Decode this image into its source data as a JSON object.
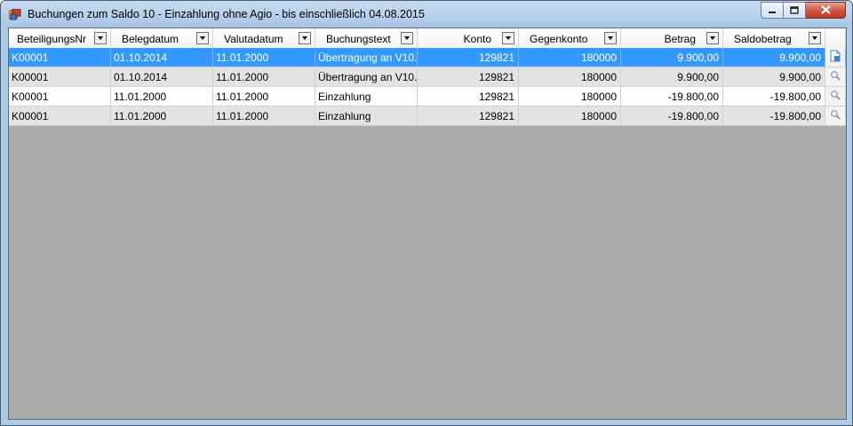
{
  "window": {
    "title": "Buchungen zum Saldo 10 - Einzahlung ohne Agio - bis einschließlich 04.08.2015",
    "app_icon": "app-window-icon",
    "caption_buttons": [
      "minimize-icon",
      "maximize-icon",
      "close-icon"
    ]
  },
  "grid": {
    "columns": [
      {
        "label": "BeteiligungsNr"
      },
      {
        "label": "Belegdatum"
      },
      {
        "label": "Valutadatum"
      },
      {
        "label": "Buchungstext"
      },
      {
        "label": "Konto"
      },
      {
        "label": "Gegenkonto"
      },
      {
        "label": "Betrag"
      },
      {
        "label": "Saldobetrag"
      }
    ],
    "rows": [
      {
        "beteiligungsnr": "K00001",
        "belegdatum": "01.10.2014",
        "valutadatum": "11.01.2000",
        "buchungstext": "Übertragung an V10...",
        "konto": "129821",
        "gegenkonto": "180000",
        "betrag": "9.900,00",
        "saldobetrag": "9.900,00",
        "icon": "document-icon",
        "selected": true
      },
      {
        "beteiligungsnr": "K00001",
        "belegdatum": "01.10.2014",
        "valutadatum": "11.01.2000",
        "buchungstext": "Übertragung an V10...",
        "konto": "129821",
        "gegenkonto": "180000",
        "betrag": "9.900,00",
        "saldobetrag": "9.900,00",
        "icon": "magnifier-icon",
        "selected": false
      },
      {
        "beteiligungsnr": "K00001",
        "belegdatum": "11.01.2000",
        "valutadatum": "11.01.2000",
        "buchungstext": "Einzahlung",
        "konto": "129821",
        "gegenkonto": "180000",
        "betrag": "-19.800,00",
        "saldobetrag": "-19.800,00",
        "icon": "magnifier-icon",
        "selected": false
      },
      {
        "beteiligungsnr": "K00001",
        "belegdatum": "11.01.2000",
        "valutadatum": "11.01.2000",
        "buchungstext": "Einzahlung",
        "konto": "129821",
        "gegenkonto": "180000",
        "betrag": "-19.800,00",
        "saldobetrag": "-19.800,00",
        "icon": "magnifier-icon",
        "selected": false
      }
    ]
  },
  "colors": {
    "selection": "#3399ff",
    "alt_row": "#e3e3e3",
    "empty_area": "#ababab"
  }
}
